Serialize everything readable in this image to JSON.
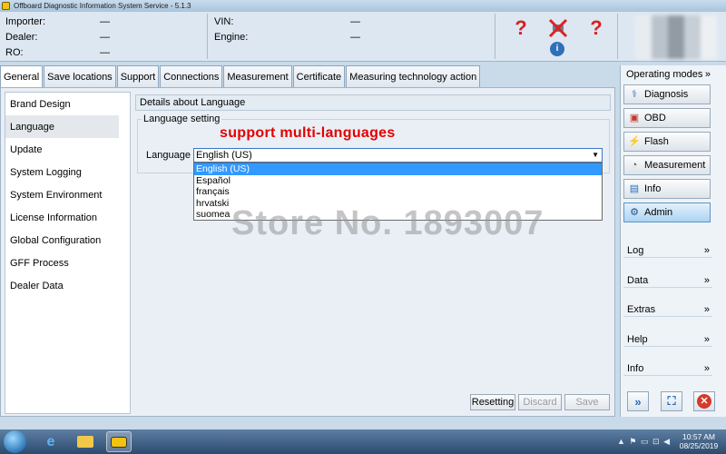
{
  "window": {
    "title": "Offboard Diagnostic Information System Service - 5.1.3"
  },
  "header": {
    "left": [
      {
        "label": "Importer:",
        "value": "—"
      },
      {
        "label": "Dealer:",
        "value": "—"
      },
      {
        "label": "RO:",
        "value": "—"
      }
    ],
    "right": [
      {
        "label": "VIN:",
        "value": "—"
      },
      {
        "label": "Engine:",
        "value": "—"
      }
    ],
    "icons": [
      "help-car-icon",
      "cancel-x-icon",
      "help-question-icon",
      "info-icon"
    ]
  },
  "tabs": [
    "General",
    "Save locations",
    "Support",
    "Connections",
    "Measurement",
    "Certificate",
    "Measuring technology action"
  ],
  "active_tab": "General",
  "nav": {
    "items": [
      "Brand Design",
      "Language",
      "Update",
      "System Logging",
      "System Environment",
      "License Information",
      "Global Configuration",
      "GFF Process",
      "Dealer Data"
    ],
    "active": "Language"
  },
  "details": {
    "header": "Details about Language",
    "group_title": "Language setting",
    "promo_text": "support multi-languages",
    "language_label": "Language",
    "selected_language": "English (US)",
    "options": [
      "English (US)",
      "Español",
      "français",
      "hrvatski",
      "suomea"
    ]
  },
  "watermark": "Store No. 1893007",
  "buttons": {
    "resetting": "Resetting",
    "discard": "Discard",
    "save": "Save"
  },
  "right_panel": {
    "operating_modes_label": "Operating modes",
    "modes": [
      {
        "label": "Diagnosis",
        "icon": "stethoscope-icon"
      },
      {
        "label": "OBD",
        "icon": "engine-icon"
      },
      {
        "label": "Flash",
        "icon": "flash-icon"
      },
      {
        "label": "Measurement",
        "icon": "gauge-icon"
      },
      {
        "label": "Info",
        "icon": "book-icon"
      },
      {
        "label": "Admin",
        "icon": "admin-icon"
      }
    ],
    "active_mode": "Admin",
    "sections": [
      "Log",
      "Data",
      "Extras",
      "Help",
      "Info"
    ]
  },
  "taskbar": {
    "time": "10:57 AM",
    "date": "08/25/2019"
  },
  "colors": {
    "selection": "#3399ff",
    "promo": "#e30000",
    "active_mode": "#acd4f3"
  }
}
